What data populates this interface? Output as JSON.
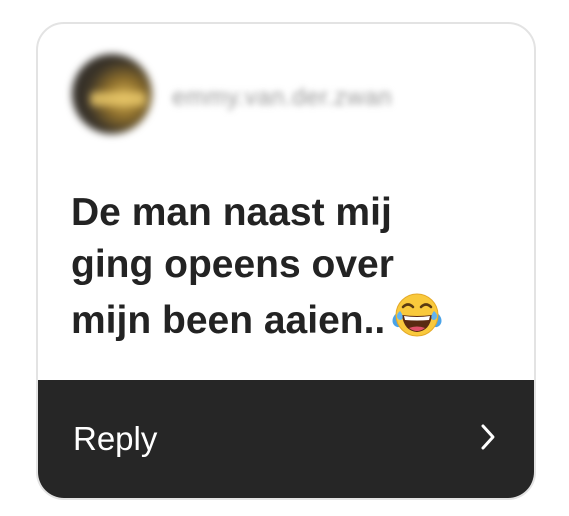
{
  "story_reply": {
    "username": "emmy.van.der.zwan",
    "message_lines": [
      "De man naast mij",
      "ging opeens over",
      "mijn been aaien.."
    ],
    "emoji": "face-with-tears-of-joy",
    "reply_label": "Reply",
    "chevron_icon": "chevron-right-icon"
  },
  "colors": {
    "card_bg": "#ffffff",
    "reply_bar_bg": "#262626",
    "message_text": "#232323",
    "reply_text": "#ffffff"
  }
}
